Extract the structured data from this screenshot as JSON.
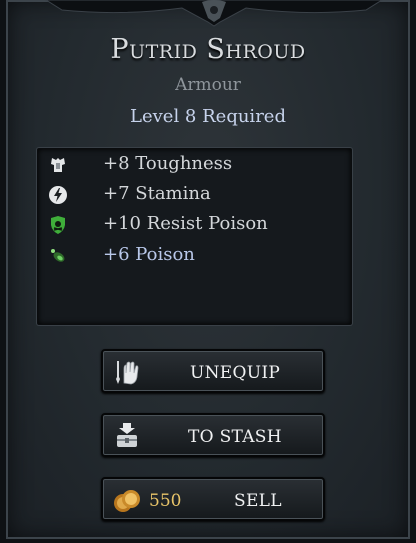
{
  "item": {
    "name": "Putrid Shroud",
    "type": "Armour",
    "requirement": "Level 8 Required"
  },
  "stats": [
    {
      "text": "+8 Toughness",
      "icon": "armour-icon",
      "color": "#d4d7da"
    },
    {
      "text": "+7 Stamina",
      "icon": "lightning-icon",
      "color": "#d4d7da"
    },
    {
      "text": "+10 Resist Poison",
      "icon": "poison-shield-icon",
      "color": "#d4d7da"
    },
    {
      "text": "+6 Poison",
      "icon": "poison-vial-icon",
      "color": "#b9c8ea"
    }
  ],
  "buttons": {
    "unequip": "UNEQUIP",
    "stash": "TO STASH",
    "sell": "SELL",
    "sell_price": "550"
  },
  "colors": {
    "title": "#d9dcdf",
    "requirement": "#c7d3ec",
    "price": "#e8c469"
  }
}
